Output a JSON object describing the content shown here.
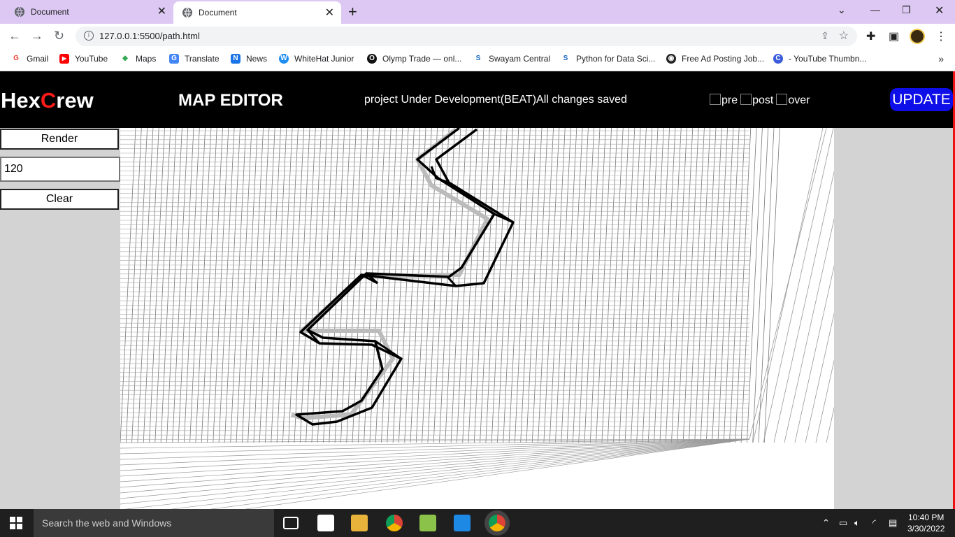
{
  "browser": {
    "tabs": [
      {
        "title": "Document"
      },
      {
        "title": "Document"
      }
    ],
    "url": "127.0.0.1:5500/path.html",
    "bookmarks": [
      {
        "label": "Gmail",
        "color": "#ea4335",
        "glyph": "G"
      },
      {
        "label": "YouTube",
        "color": "#ff0000",
        "glyph": "▶"
      },
      {
        "label": "Maps",
        "color": "#34a853",
        "glyph": "◆"
      },
      {
        "label": "Translate",
        "color": "#4285f4",
        "glyph": "G"
      },
      {
        "label": "News",
        "color": "#1a73e8",
        "glyph": "N"
      },
      {
        "label": "WhiteHat Junior",
        "color": "#1f8ef1",
        "glyph": "W"
      },
      {
        "label": "Olymp Trade — onl...",
        "color": "#111111",
        "glyph": "O"
      },
      {
        "label": "Swayam Central",
        "color": "#1565c0",
        "glyph": "S"
      },
      {
        "label": "Python for Data Sci...",
        "color": "#1565c0",
        "glyph": "S"
      },
      {
        "label": "Free Ad Posting Job...",
        "color": "#222222",
        "glyph": "◉"
      },
      {
        "label": "- YouTube Thumbn...",
        "color": "#3b5bdb",
        "glyph": "C"
      }
    ]
  },
  "app": {
    "logo_part1": "Hex",
    "logo_part2": "C",
    "logo_part3": "rew",
    "title": "MAP EDITOR",
    "status": "project Under Development(BEAT)All changes saved",
    "image_alts": [
      "pre",
      "post",
      "over"
    ],
    "update_label": "UPDATE",
    "render_label": "Render",
    "number_value": "120",
    "clear_label": "Clear",
    "accent_color": "#0e0ee8"
  },
  "taskbar": {
    "search_placeholder": "Search the web and Windows",
    "time": "10:40 PM",
    "date": "3/30/2022"
  }
}
